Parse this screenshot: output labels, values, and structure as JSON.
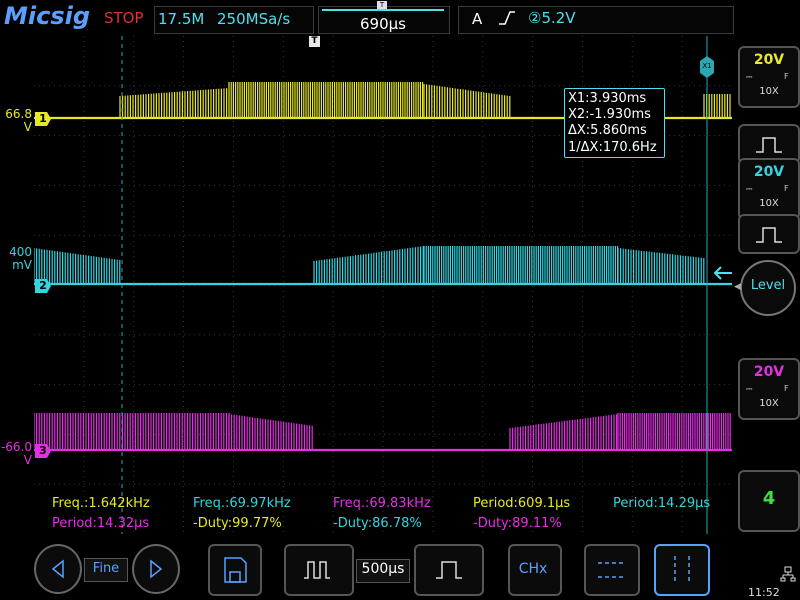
{
  "app": {
    "logo": "Micsig",
    "run_state": "STOP"
  },
  "acquisition": {
    "memory_depth": "17.5M",
    "sample_rate": "250MSa/s"
  },
  "horizontal": {
    "trigger_delay": "690µs",
    "timebase": "500µs",
    "timebase_mode": "Fine"
  },
  "trigger": {
    "mode": "A",
    "edge": "rising-edge",
    "source_glyph": "②",
    "level": "5.2V",
    "marker_glyph": "T"
  },
  "channels": [
    {
      "id": "1",
      "label_line1": "66.8",
      "label_line2": "V",
      "color": "#e8e82a",
      "volts_div": "20V",
      "probe": "10X",
      "coupling_glyph": "F"
    },
    {
      "id": "2",
      "label_line1": "400",
      "label_line2": "mV",
      "color": "#34d4e0",
      "volts_div": "20V",
      "probe": "10X",
      "coupling_glyph": "F"
    },
    {
      "id": "3",
      "label_line1": "-66.0",
      "label_line2": "V",
      "color": "#e62ee6",
      "volts_div": "20V",
      "probe": "10X",
      "coupling_glyph": "F"
    }
  ],
  "cursors": {
    "x1_tag": "X1",
    "x1": "X1:3.930ms",
    "x2": "X2:-1.930ms",
    "delta": "ΔX:5.860ms",
    "inv_delta": "1/ΔX:170.6Hz"
  },
  "measurements": {
    "row1": [
      {
        "text": "Freq.:1.642kHz",
        "color": "#e8e82a"
      },
      {
        "text": "Freq.:69.97kHz",
        "color": "#34d4e0"
      },
      {
        "text": "Freq.:69.83kHz",
        "color": "#e62ee6"
      },
      {
        "text": "Period:609.1µs",
        "color": "#e8e82a"
      },
      {
        "text": "Period:14.29µs",
        "color": "#34d4e0"
      }
    ],
    "row2": [
      {
        "text": "Period:14.32µs",
        "color": "#e62ee6"
      },
      {
        "text": "-Duty:99.77%",
        "color": "#e8e82a"
      },
      {
        "text": "-Duty:86.78%",
        "color": "#34d4e0"
      },
      {
        "text": "-Duty:89.11%",
        "color": "#e62ee6"
      }
    ]
  },
  "right_panel": {
    "level_label": "Level",
    "channel_count": "4"
  },
  "bottom_bar": {
    "chx_label": "CHx",
    "clock": "11:52"
  },
  "icons": {
    "prev": "chevron-left-icon",
    "next": "chevron-right-icon",
    "save": "save-icon",
    "pulse_narrow": "pulse-narrow-icon",
    "pulse_wide": "pulse-wide-icon",
    "horizontal_cursor": "horizontal-cursor-icon",
    "vertical_cursor": "vertical-cursor-icon",
    "network": "network-icon"
  }
}
